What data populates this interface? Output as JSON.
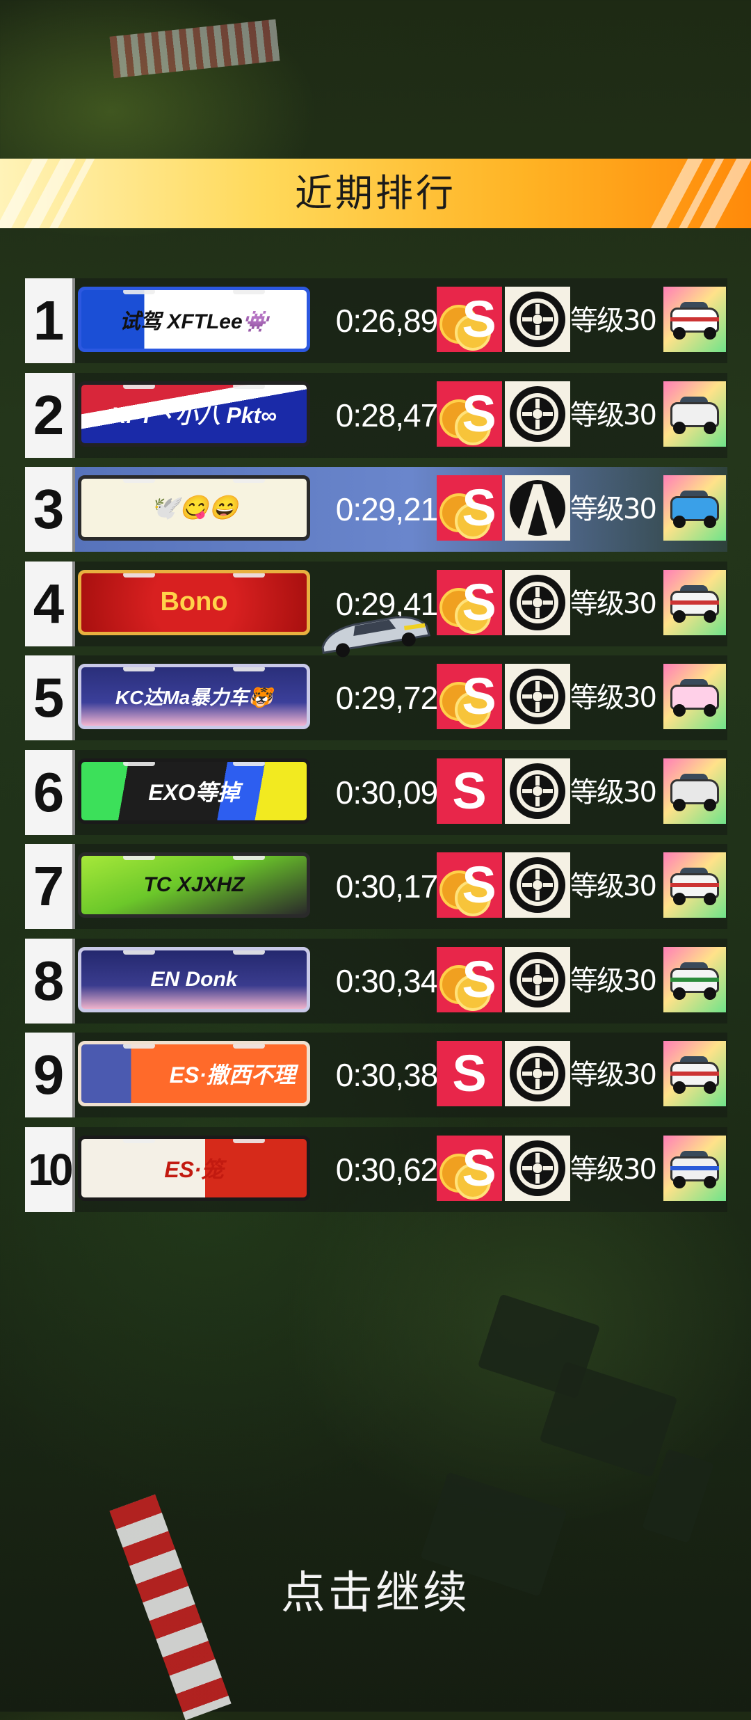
{
  "header": {
    "title": "近期排行"
  },
  "leaderboard": [
    {
      "rank": "1",
      "plate": "试驾 XFTLee👾",
      "time": "0:26,89",
      "badge": "S",
      "badge_gold": true,
      "tire": "standard-tire-icon",
      "level": "等级30",
      "car_color": "#ffffff"
    },
    {
      "rank": "2",
      "plate": "XFT丶小八 Pkt∞",
      "time": "0:28,47",
      "badge": "S",
      "badge_gold": true,
      "tire": "standard-tire-icon",
      "level": "等级30",
      "car_color": "#f0f0f0"
    },
    {
      "rank": "3",
      "plate": "🕊️😋😄",
      "time": "0:29,21",
      "badge": "S",
      "badge_gold": true,
      "tire": "road-tire-icon",
      "level": "等级30",
      "car_color": "#3aa0e8"
    },
    {
      "rank": "4",
      "plate": "Bono",
      "time": "0:29,41",
      "badge": "S",
      "badge_gold": true,
      "tire": "standard-tire-icon",
      "level": "等级30",
      "car_color": "#f4f4f4"
    },
    {
      "rank": "5",
      "plate": "KC达Ma暴力车🐯",
      "time": "0:29,72",
      "badge": "S",
      "badge_gold": true,
      "tire": "standard-tire-icon",
      "level": "等级30",
      "car_color": "#ffd0e8"
    },
    {
      "rank": "6",
      "plate": "EXO等掉",
      "time": "0:30,09",
      "badge": "S",
      "badge_gold": false,
      "tire": "standard-tire-icon",
      "level": "等级30",
      "car_color": "#e8e8e8"
    },
    {
      "rank": "7",
      "plate": "TC XJXHZ",
      "time": "0:30,17",
      "badge": "S",
      "badge_gold": true,
      "tire": "standard-tire-icon",
      "level": "等级30",
      "car_color": "#f4f4f4"
    },
    {
      "rank": "8",
      "plate": "EN Donk",
      "time": "0:30,34",
      "badge": "S",
      "badge_gold": true,
      "tire": "standard-tire-icon",
      "level": "等级30",
      "car_color": "#f4f4f4"
    },
    {
      "rank": "9",
      "plate": "ES·撒西不理",
      "time": "0:30,38",
      "badge": "S",
      "badge_gold": false,
      "tire": "standard-tire-icon",
      "level": "等级30",
      "car_color": "#f4f4f4"
    },
    {
      "rank": "10",
      "plate": "ES·笼",
      "time": "0:30,62",
      "badge": "S",
      "badge_gold": true,
      "tire": "standard-tire-icon",
      "level": "等级30",
      "car_color": "#f0f0f0"
    }
  ],
  "footer": {
    "continue_label": "点击继续"
  },
  "colors": {
    "banner_start": "#fff3b8",
    "banner_end": "#ff8a0a",
    "badge_red": "#e8264a",
    "highlight_row": "#5a78c2"
  }
}
